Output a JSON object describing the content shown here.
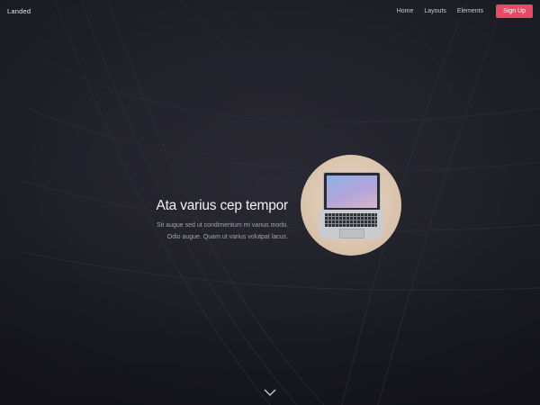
{
  "header": {
    "logo": "Landed",
    "nav": [
      "Home",
      "Layouts",
      "Elements"
    ],
    "signup_label": "Sign Up"
  },
  "hero": {
    "title": "Ata varius cep tempor",
    "subtitle_line1": "Sit augue sed ut condimentum mi varius morbi.",
    "subtitle_line2": "Odio augue. Quam ut varius volutpat lacus."
  },
  "colors": {
    "accent": "#e44c65",
    "background": "#1c1c24"
  },
  "icons": {
    "scroll": "chevron-down-icon"
  }
}
